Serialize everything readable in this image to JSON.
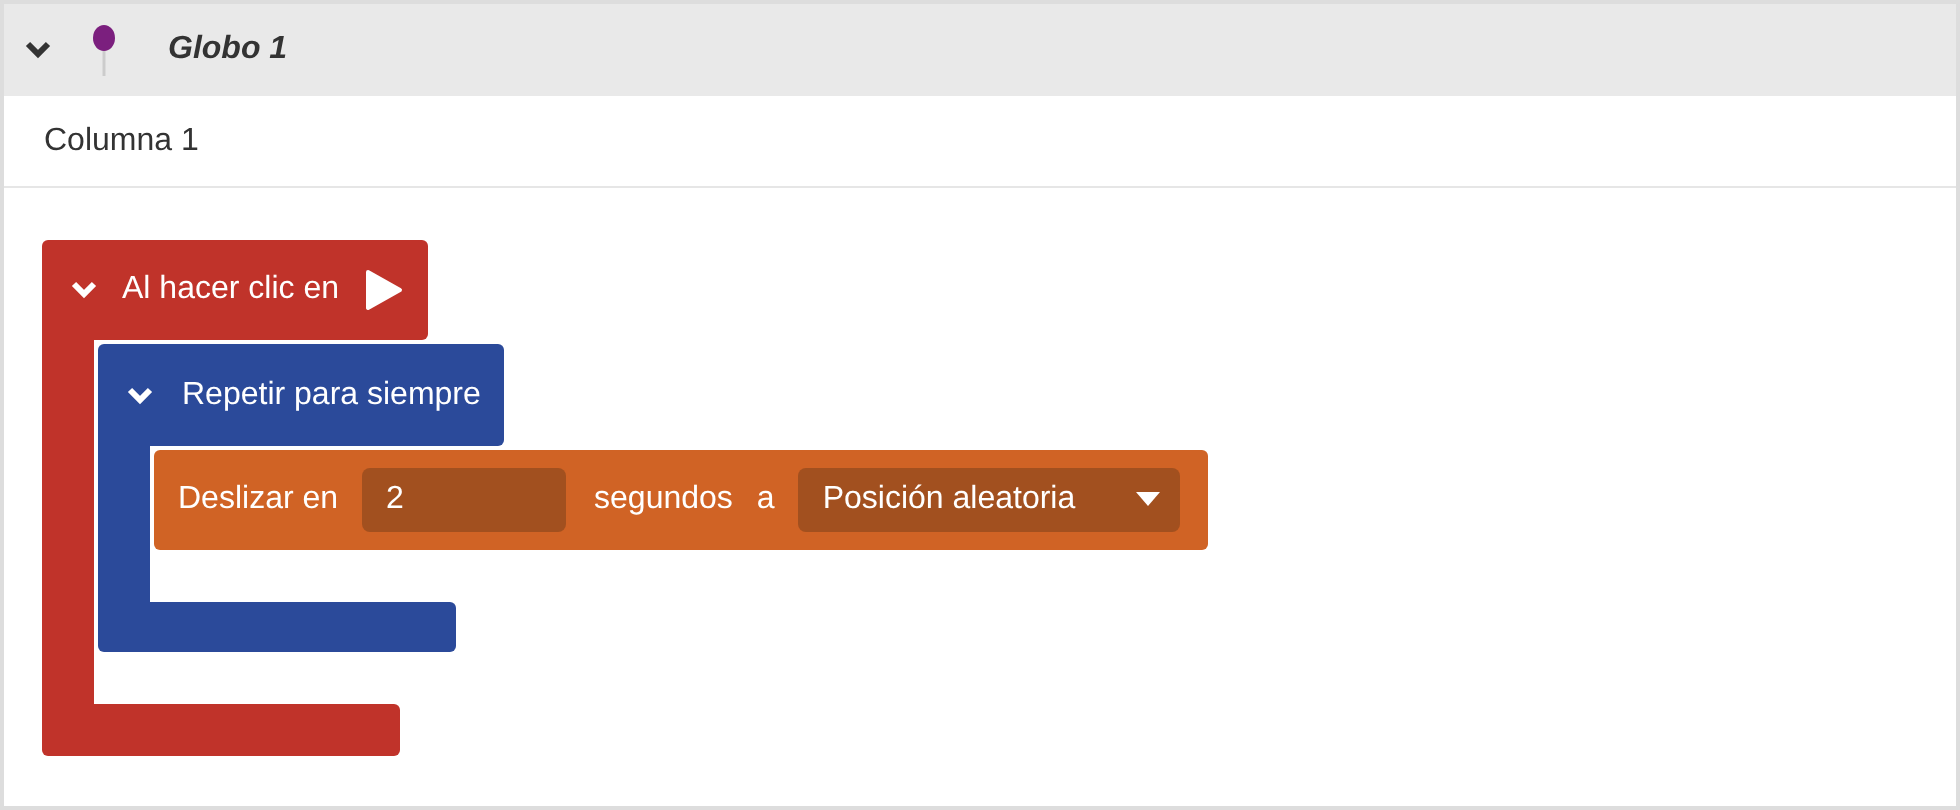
{
  "sprite": {
    "name": "Globo 1",
    "expanded": true
  },
  "column": {
    "label": "Columna 1"
  },
  "script": {
    "kind": "event",
    "label": "Al hacer clic en",
    "expanded": true,
    "children": [
      {
        "kind": "loop",
        "label": "Repetir para siempre",
        "expanded": true,
        "children": [
          {
            "kind": "motion",
            "parts": [
              {
                "kind": "text",
                "text": "Deslizar en"
              },
              {
                "kind": "input",
                "value": "2"
              },
              {
                "kind": "text",
                "text": "segundos"
              },
              {
                "kind": "text",
                "text": "a"
              },
              {
                "kind": "dropdown",
                "value": "Posición aleatoria"
              }
            ]
          }
        ]
      }
    ]
  }
}
